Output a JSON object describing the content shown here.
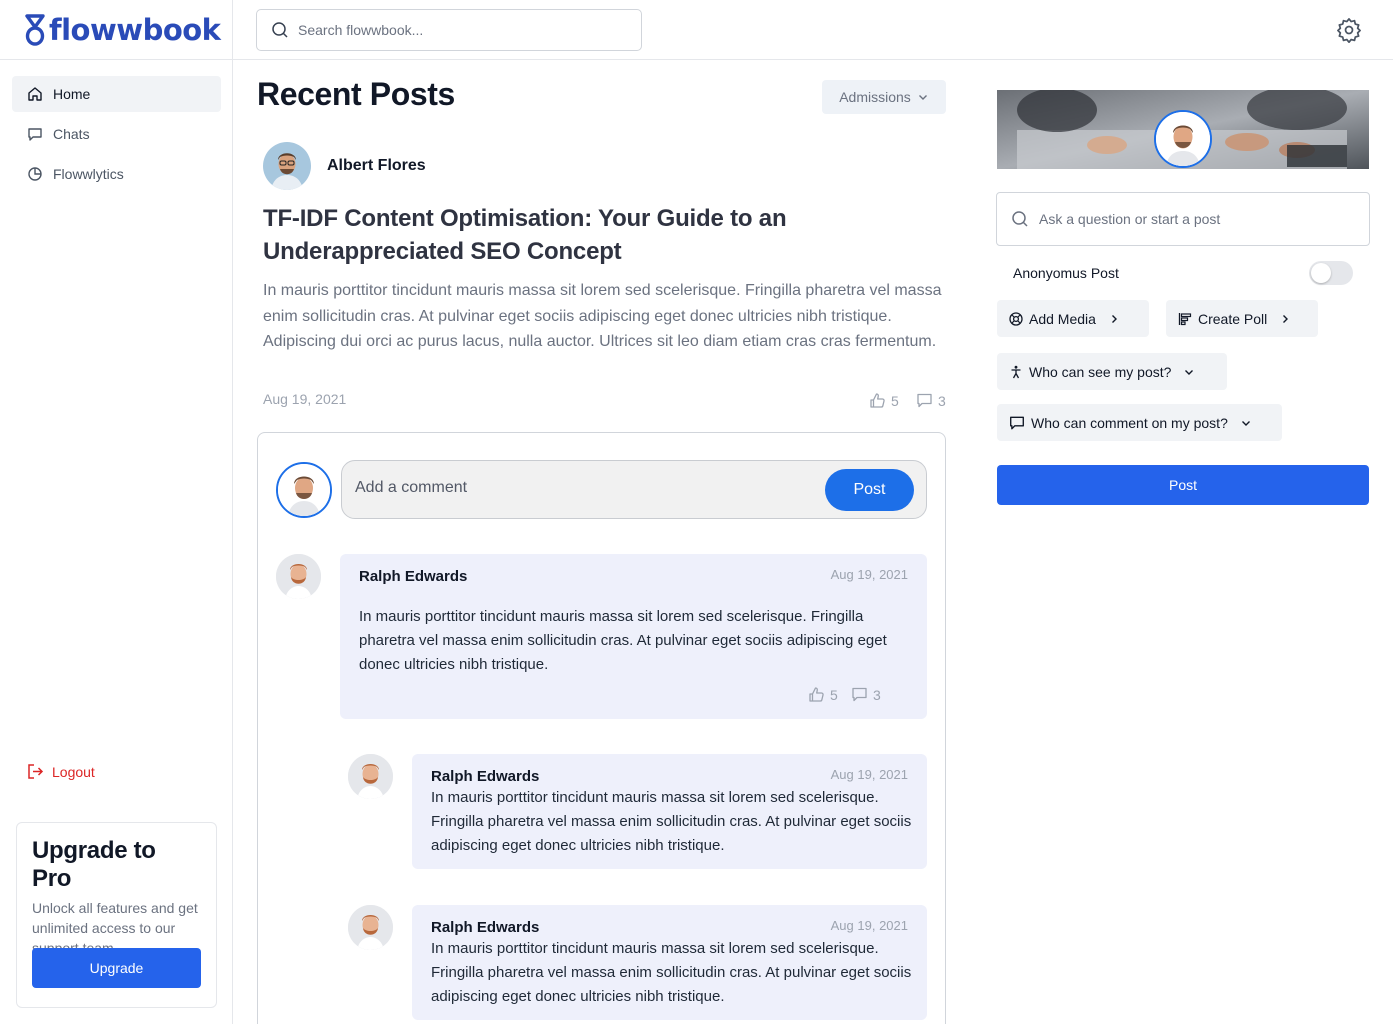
{
  "brand": {
    "name": "flowwbook",
    "color": "#2a4bb8"
  },
  "search": {
    "placeholder": "Search flowwbook..."
  },
  "sidebar": {
    "items": [
      {
        "label": "Home",
        "icon": "home-icon",
        "active": true
      },
      {
        "label": "Chats",
        "icon": "chat-icon"
      },
      {
        "label": "Flowwlytics",
        "icon": "pie-chart-icon"
      }
    ],
    "logout_label": "Logout",
    "upgrade": {
      "title": "Upgrade to Pro",
      "description": "Unlock all features and get unlimited access to our support team.",
      "button_label": "Upgrade"
    }
  },
  "main": {
    "title": "Recent Posts",
    "filter_label": "Admissions",
    "post": {
      "author": "Albert Flores",
      "title": "TF-IDF Content Optimisation: Your Guide to an Underappreciated SEO Concept",
      "body": "In mauris porttitor tincidunt mauris massa sit lorem sed scelerisque. Fringilla pharetra vel massa enim sollicitudin cras. At pulvinar eget sociis adipiscing eget donec ultricies nibh tristique. Adipiscing dui orci ac purus lacus, nulla auctor. Ultrices sit leo diam etiam cras cras fermentum.",
      "date": "Aug 19, 2021",
      "likes": "5",
      "comments": "3"
    },
    "comment_input": {
      "placeholder": "Add a comment",
      "button_label": "Post"
    },
    "comments": [
      {
        "author": "Ralph Edwards",
        "date": "Aug 19, 2021",
        "text": "In mauris porttitor tincidunt mauris massa sit lorem sed scelerisque. Fringilla pharetra vel massa enim sollicitudin cras. At pulvinar eget sociis adipiscing eget donec ultricies nibh tristique.",
        "likes": "5",
        "replies": "3"
      },
      {
        "author": "Ralph Edwards",
        "date": "Aug 19, 2021",
        "text": "In mauris porttitor tincidunt mauris massa sit lorem sed scelerisque. Fringilla pharetra vel massa enim sollicitudin cras. At pulvinar eget sociis adipiscing eget donec ultricies nibh tristique."
      },
      {
        "author": "Ralph Edwards",
        "date": "Aug 19, 2021",
        "text": "In mauris porttitor tincidunt mauris massa sit lorem sed scelerisque. Fringilla pharetra vel massa enim sollicitudin cras. At pulvinar eget sociis adipiscing eget donec ultricies nibh tristique."
      }
    ]
  },
  "composer": {
    "placeholder": "Ask a question or start a post",
    "anonymous_label": "Anonyomus Post",
    "anonymous_enabled": false,
    "add_media_label": "Add Media",
    "create_poll_label": "Create Poll",
    "visibility_label": "Who can see my post?",
    "comment_permission_label": "Who can comment on my post?",
    "post_button_label": "Post"
  },
  "colors": {
    "primary": "#2563eb",
    "comment_bg": "#eef0fb",
    "logout": "#dc2626"
  }
}
